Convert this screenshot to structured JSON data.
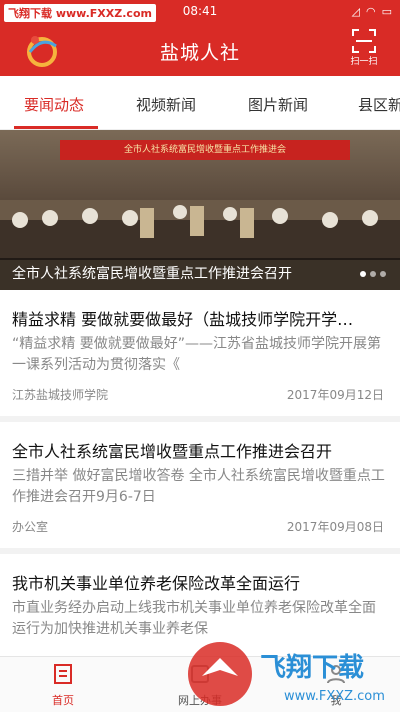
{
  "status": {
    "watermark": "飞翔下载 www.FXXZ.com",
    "time": "08:41",
    "battery": "▭"
  },
  "appbar": {
    "title": "盐城人社",
    "scan_label": "扫一扫"
  },
  "tabs": [
    {
      "label": "要闻动态",
      "active": true
    },
    {
      "label": "视频新闻",
      "active": false
    },
    {
      "label": "图片新闻",
      "active": false
    },
    {
      "label": "县区新",
      "active": false
    }
  ],
  "hero": {
    "banner": "全市人社系统富民增收暨重点工作推进会",
    "caption": "全市人社系统富民增收暨重点工作推进会召开",
    "slides": 3,
    "current": 1
  },
  "news": [
    {
      "title": "精益求精 要做就要做最好（盐城技师学院开学…",
      "summary": "“精益求精 要做就要做最好”——江苏省盐城技师学院开展第一课系列活动为贯彻落实《",
      "source": "江苏盐城技师学院",
      "date": "2017年09月12日"
    },
    {
      "title": "全市人社系统富民增收暨重点工作推进会召开",
      "summary": "三措并举 做好富民增收答卷 全市人社系统富民增收暨重点工作推进会召开9月6-7日",
      "source": "办公室",
      "date": "2017年09月08日"
    },
    {
      "title": "我市机关事业单位养老保险改革全面运行",
      "summary": "市直业务经办启动上线我市机关事业单位养老保险改革全面运行为加快推进机关事业养老保",
      "source": "",
      "date": ""
    }
  ],
  "tabbar": [
    {
      "label": "首页",
      "active": true
    },
    {
      "label": "网上办事",
      "active": false
    },
    {
      "label": "我",
      "active": false
    }
  ],
  "watermark_logo": {
    "text": "飞翔下载",
    "url": "www.FXXZ.com"
  },
  "colors": {
    "brand": "#d92b26"
  }
}
